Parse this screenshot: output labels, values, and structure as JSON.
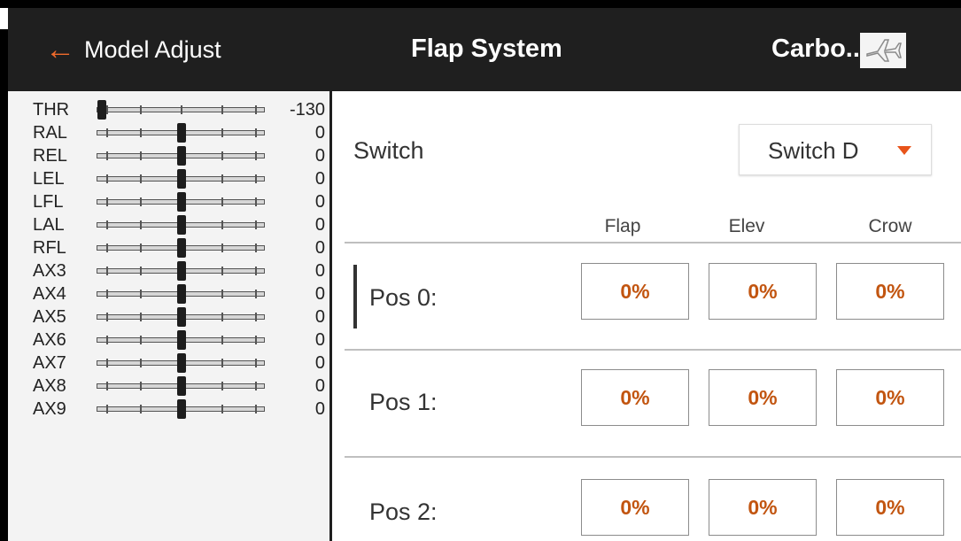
{
  "header": {
    "back_label": "Model Adjust",
    "title": "Flap System",
    "model_name": "Carbo...",
    "model_icon": "airplane-icon",
    "accent_color": "#ef6a2b"
  },
  "channels": [
    {
      "name": "THR",
      "value": "-130",
      "position": -1.0
    },
    {
      "name": "RAL",
      "value": "0",
      "position": 0.0
    },
    {
      "name": "REL",
      "value": "0",
      "position": 0.0
    },
    {
      "name": "LEL",
      "value": "0",
      "position": 0.0
    },
    {
      "name": "LFL",
      "value": "0",
      "position": 0.0
    },
    {
      "name": "LAL",
      "value": "0",
      "position": 0.0
    },
    {
      "name": "RFL",
      "value": "0",
      "position": 0.0
    },
    {
      "name": "AX3",
      "value": "0",
      "position": 0.0
    },
    {
      "name": "AX4",
      "value": "0",
      "position": 0.0
    },
    {
      "name": "AX5",
      "value": "0",
      "position": 0.0
    },
    {
      "name": "AX6",
      "value": "0",
      "position": 0.0
    },
    {
      "name": "AX7",
      "value": "0",
      "position": 0.0
    },
    {
      "name": "AX8",
      "value": "0",
      "position": 0.0
    },
    {
      "name": "AX9",
      "value": "0",
      "position": 0.0
    }
  ],
  "switch": {
    "label": "Switch",
    "selected": "Switch D"
  },
  "columns": [
    "Flap",
    "Elev",
    "Crow"
  ],
  "positions": [
    {
      "label": "Pos 0:",
      "active": true,
      "values": [
        "0%",
        "0%",
        "0%"
      ]
    },
    {
      "label": "Pos 1:",
      "active": false,
      "values": [
        "0%",
        "0%",
        "0%"
      ]
    },
    {
      "label": "Pos 2:",
      "active": false,
      "values": [
        "0%",
        "0%",
        "0%"
      ]
    }
  ]
}
